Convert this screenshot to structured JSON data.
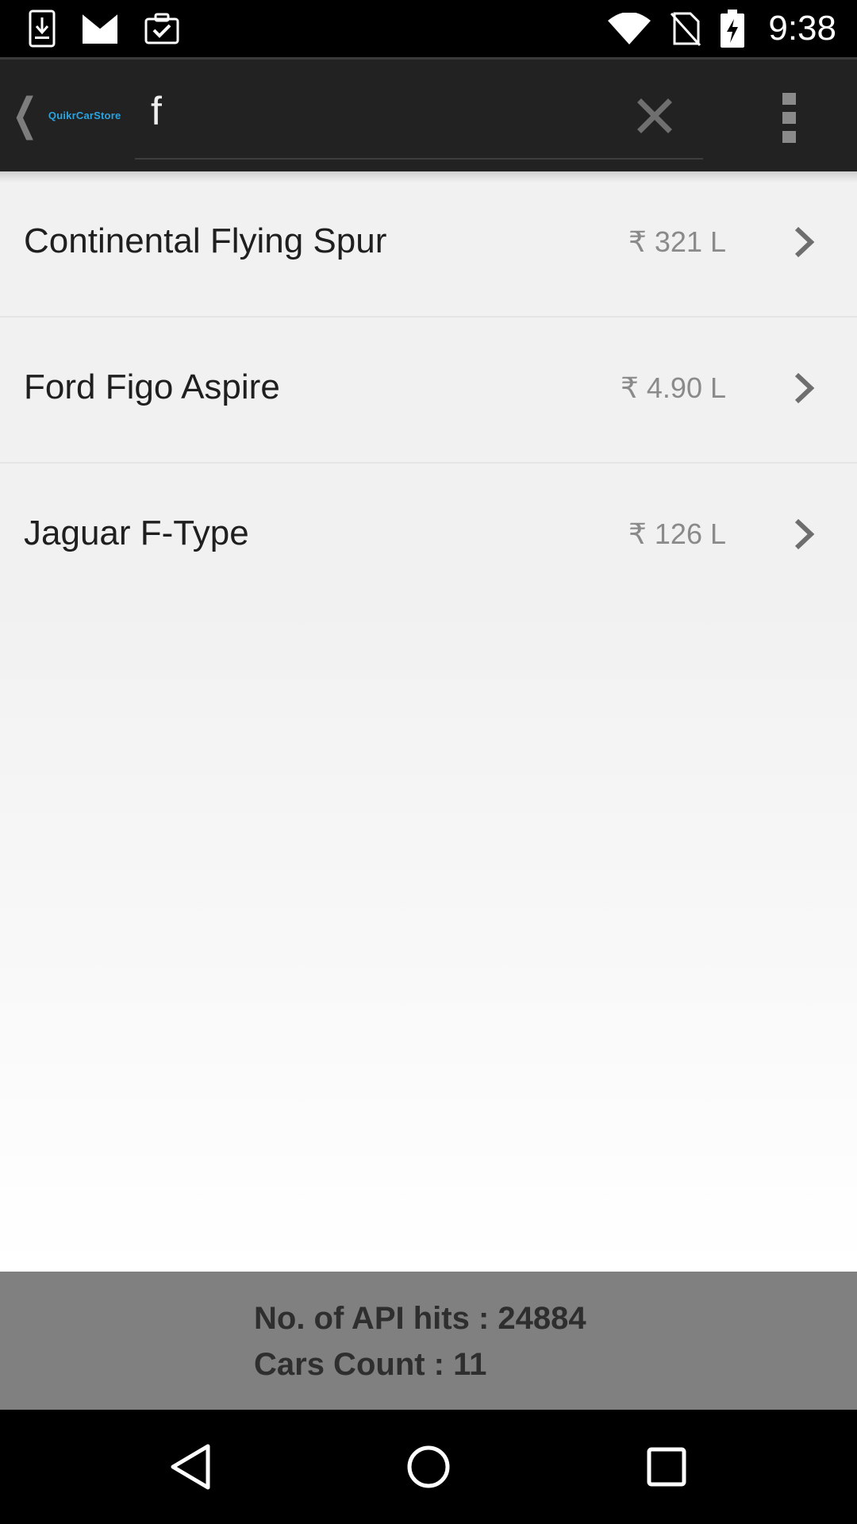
{
  "status_bar": {
    "time": "9:38",
    "left_icons": [
      "download-icon",
      "gmail-icon",
      "clipboard-check-icon"
    ],
    "right_icons": [
      "wifi-icon",
      "no-sim-icon",
      "battery-charging-icon"
    ]
  },
  "action_bar": {
    "logo": "QuikrCarStore",
    "search_query": "f"
  },
  "results": [
    {
      "name": "Continental Flying Spur",
      "price": "₹ 321 L"
    },
    {
      "name": "Ford Figo Aspire",
      "price": "₹ 4.90 L"
    },
    {
      "name": "Jaguar F-Type",
      "price": "₹ 126 L"
    }
  ],
  "footer": {
    "api_hits": "No. of API hits : 24884",
    "cars_count": "Cars Count : 11"
  },
  "colors": {
    "action_bar_bg": "#222222",
    "logo": "#2aa3e0",
    "footer_bg": "#808080"
  }
}
